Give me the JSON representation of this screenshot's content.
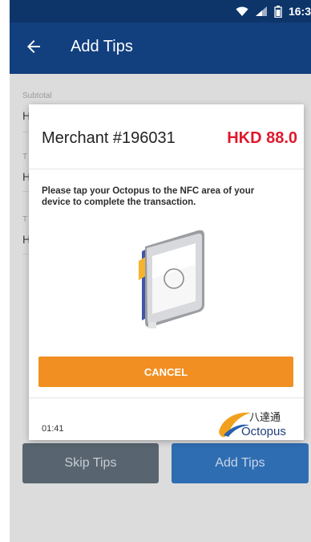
{
  "status_bar": {
    "time": "16:3",
    "wifi_icon": "wifi-icon",
    "signal_icon": "signal-icon",
    "battery_icon": "battery-icon"
  },
  "app_bar": {
    "title": "Add Tips",
    "back_icon": "arrow-left-icon"
  },
  "background_form": {
    "subtotal_label": "Subtotal",
    "row_prefix": "H",
    "row_label_prefix": "T"
  },
  "dialog": {
    "merchant": "Merchant #196031",
    "amount": "HKD 88.0",
    "instruction": "Please tap your Octopus to the NFC area of your device to complete the transaction.",
    "cancel_label": "CANCEL",
    "timer": "01:41",
    "logo_chinese": "八達通",
    "logo_text": "Octopus"
  },
  "footer_buttons": {
    "skip_label": "Skip Tips",
    "add_label": "Add Tips"
  },
  "colors": {
    "app_bar": "#123f7e",
    "status_bar": "#0d3569",
    "amount": "#e0182d",
    "cancel": "#f28f22",
    "skip_button": "#586570",
    "add_button": "#2f6db2"
  }
}
